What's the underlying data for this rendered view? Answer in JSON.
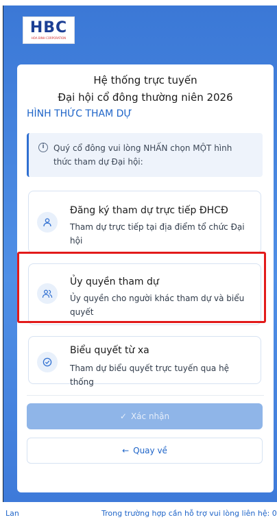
{
  "logo": {
    "text": "HBC",
    "subtext": "HOA BINH CORPORATION"
  },
  "card": {
    "title_line1": "Hệ thống trực tuyến",
    "title_line2": "Đại hội cổ đông thường niên 2026",
    "section_heading": "HÌNH THỨC THAM DỰ",
    "info_text": "Quý cổ đông vui lòng NHẤN chọn MỘT hình thức tham dự Đại hội:",
    "options": [
      {
        "title": "Đăng ký tham dự trực tiếp ĐHCĐ",
        "description": "Tham dự trực tiếp tại địa điểm tổ chức Đại hội",
        "icon": "person-icon"
      },
      {
        "title": "Ủy quyền tham dự",
        "description": "Ủy quyền cho người khác tham dự và biểu quyết",
        "icon": "people-icon"
      },
      {
        "title": "Biểu quyết từ xa",
        "description": "Tham dự biểu quyết trực tuyến qua hệ thống",
        "icon": "check-circle-icon"
      }
    ],
    "confirm_label": "Xác nhận",
    "back_label": "Quay về"
  },
  "footer": {
    "left_text": "Lan",
    "right_text": "Trong trường hợp cần hỗ trợ vui lòng liên hệ: 0"
  },
  "colors": {
    "primary": "#1e64c8",
    "highlight": "#e21a1a",
    "background_gradient": "#4f8fe6"
  }
}
